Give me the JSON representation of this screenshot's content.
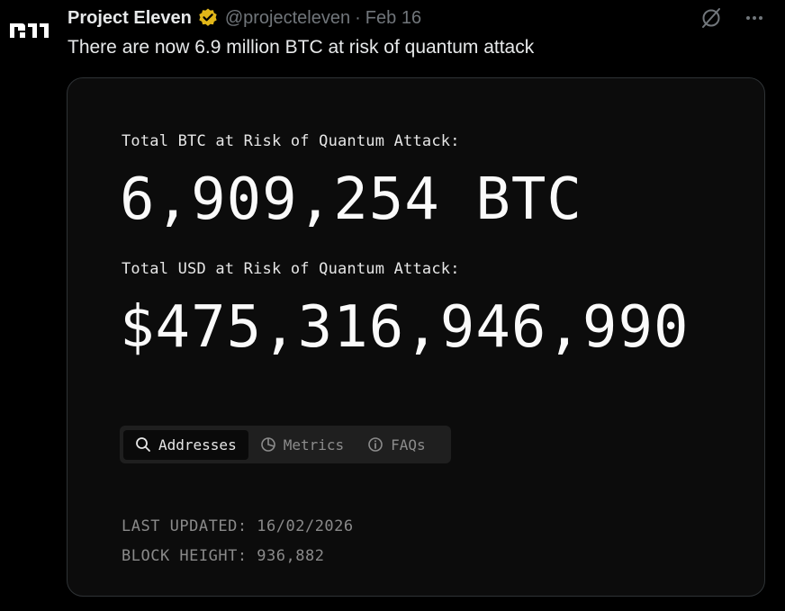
{
  "tweet": {
    "author_name": "Project Eleven",
    "handle": "@projecteleven",
    "separator": "·",
    "date": "Feb 16",
    "text": "There are now 6.9 million BTC at risk of quantum attack",
    "avatar_logo_text": "P11",
    "verified_color": "#e2b719"
  },
  "card": {
    "btc_label": "Total BTC at Risk of Quantum Attack:",
    "btc_value": "6,909,254 BTC",
    "usd_label": "Total USD at Risk of Quantum Attack:",
    "usd_value": "$475,316,946,990",
    "tabs": [
      {
        "label": "Addresses",
        "icon": "search-icon",
        "active": true
      },
      {
        "label": "Metrics",
        "icon": "pie-chart-icon",
        "active": false
      },
      {
        "label": "FAQs",
        "icon": "info-icon",
        "active": false
      }
    ],
    "last_updated": "LAST UPDATED: 16/02/2026",
    "block_height": "BLOCK HEIGHT: 936,882"
  },
  "icons": {
    "top_right": [
      "grok-icon",
      "more-icon"
    ]
  }
}
